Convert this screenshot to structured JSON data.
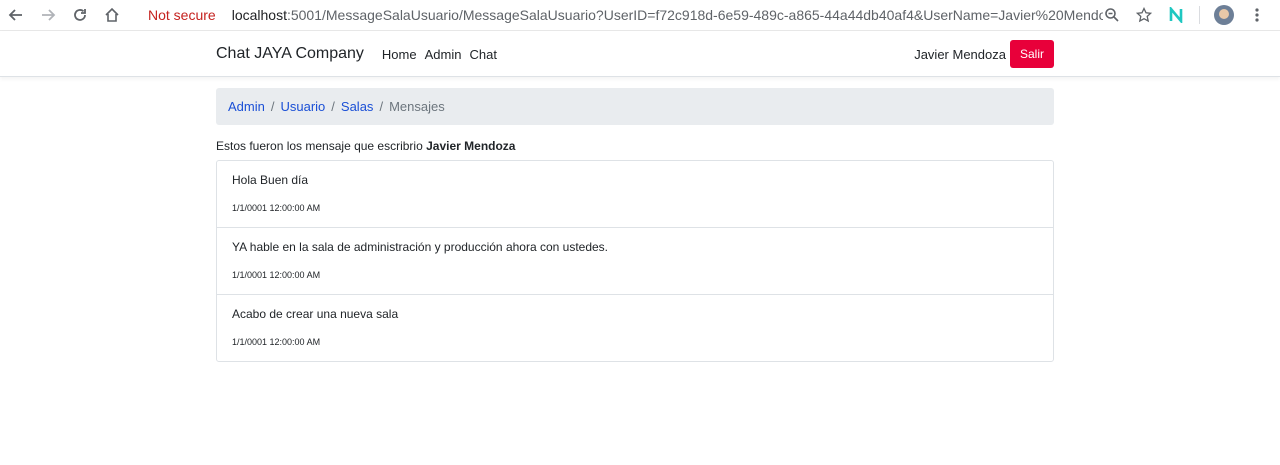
{
  "browser": {
    "not_secure": "Not secure",
    "url_host": "localhost",
    "url_rest": ":5001/MessageSalaUsuario/MessageSalaUsuario?UserID=f72c918d-6e59-489c-a865-44a44db40af4&UserName=Javier%20Mendoza&..."
  },
  "navbar": {
    "brand": "Chat JAYA Company",
    "links": [
      "Home",
      "Admin",
      "Chat"
    ],
    "user_name": "Javier Mendoza",
    "logout_label": "Salir"
  },
  "breadcrumb": {
    "items": [
      "Admin",
      "Usuario",
      "Salas"
    ],
    "active": "Mensajes",
    "separator": "/"
  },
  "intro": {
    "text": "Estos fueron los mensaje que escribrio ",
    "user": "Javier Mendoza"
  },
  "messages": [
    {
      "text": "Hola Buen día",
      "date": "1/1/0001 12:00:00 AM"
    },
    {
      "text": "YA hable en la sala de administración y producción ahora con ustedes.",
      "date": "1/1/0001 12:00:00 AM"
    },
    {
      "text": "Acabo de crear una nueva sala",
      "date": "1/1/0001 12:00:00 AM"
    }
  ],
  "colors": {
    "accent_link": "#1a4fd6",
    "logout_button": "#e8003a",
    "not_secure": "#c5221f"
  }
}
